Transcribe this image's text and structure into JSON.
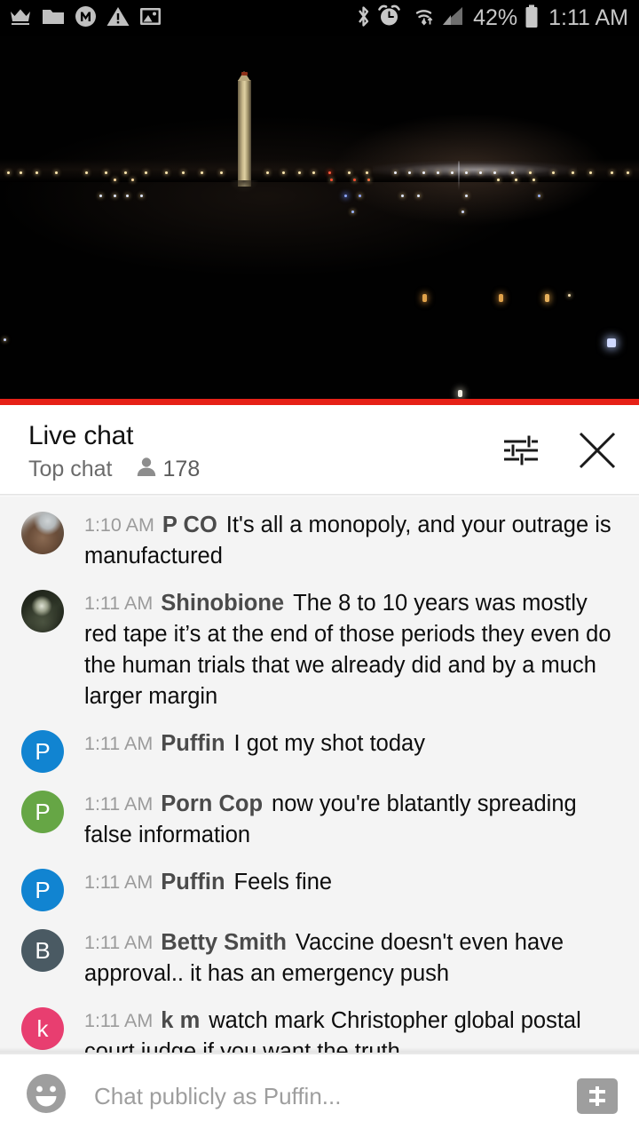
{
  "statusbar": {
    "left_icons": [
      "crown-icon",
      "folder-icon",
      "m-circle-icon",
      "warning-triangle-icon",
      "image-icon"
    ],
    "right_icons": [
      "bluetooth-icon",
      "alarm-clock-icon",
      "wifi-icon",
      "signal-bars-icon",
      "battery-icon"
    ],
    "battery_percent": "42%",
    "time": "1:11 AM"
  },
  "video": {
    "description": "washington-monument-night-livestream",
    "progress_color": "#e62117"
  },
  "chat_header": {
    "title": "Live chat",
    "mode": "Top chat",
    "viewer_count": "178",
    "settings_icon": "tune-sliders-icon",
    "close_icon": "close-x-icon"
  },
  "messages": [
    {
      "time": "1:10 AM",
      "author": "P CO",
      "text": "It's all a monopoly, and your outrage is manufactured",
      "avatar_kind": "photo1",
      "avatar_letter": "",
      "avatar_color": "#7a6a58"
    },
    {
      "time": "1:11 AM",
      "author": "Shinobione",
      "text": "The 8 to 10 years was mostly red tape it’s at the end of those periods they even do the human trials that we already did and by a much larger margin",
      "avatar_kind": "photo2",
      "avatar_letter": "",
      "avatar_color": "#23291c"
    },
    {
      "time": "1:11 AM",
      "author": "Puffin",
      "text": "I got my shot today",
      "avatar_kind": "letter",
      "avatar_letter": "P",
      "avatar_color": "#1184d1"
    },
    {
      "time": "1:11 AM",
      "author": "Porn Cop",
      "text": "now you're blatantly spreading false information",
      "avatar_kind": "letter",
      "avatar_letter": "P",
      "avatar_color": "#66a645"
    },
    {
      "time": "1:11 AM",
      "author": "Puffin",
      "text": "Feels fine",
      "avatar_kind": "letter",
      "avatar_letter": "P",
      "avatar_color": "#1184d1"
    },
    {
      "time": "1:11 AM",
      "author": "Betty Smith",
      "text": "Vaccine doesn't even have approval.. it has an emergency push",
      "avatar_kind": "letter",
      "avatar_letter": "B",
      "avatar_color": "#4a5a63"
    },
    {
      "time": "1:11 AM",
      "author": "k m",
      "text": "watch mark Christopher global postal court judge if you want the truth",
      "avatar_kind": "letter",
      "avatar_letter": "k",
      "avatar_color": "#e83e70"
    }
  ],
  "composer": {
    "emoji_icon": "smiley-face-icon",
    "placeholder": "Chat publicly as Puffin...",
    "superchat_icon": "dollar-superchat-icon"
  }
}
